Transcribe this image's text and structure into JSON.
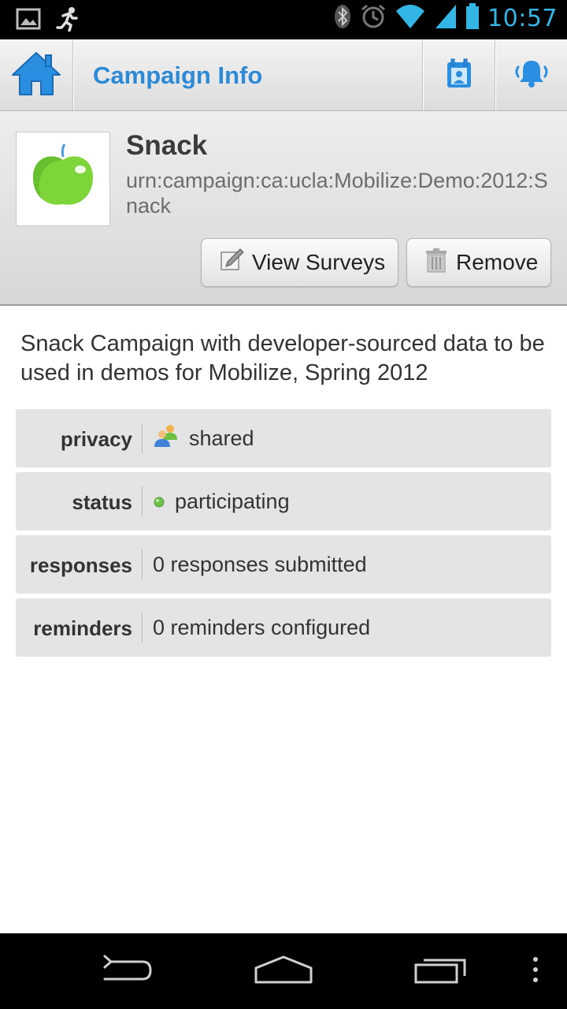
{
  "status_bar": {
    "time": "10:57",
    "icons": [
      "picture-icon",
      "running-icon",
      "bluetooth-icon",
      "alarm-icon",
      "wifi-icon",
      "signal-icon",
      "battery-icon"
    ]
  },
  "action_bar": {
    "title": "Campaign Info",
    "icons": [
      "home-icon",
      "calendar-contact-icon",
      "bell-icon"
    ]
  },
  "campaign": {
    "name": "Snack",
    "urn": "urn:campaign:ca:ucla:Mobilize:Demo:2012:Snack",
    "description": "Snack Campaign with developer-sourced data to be used in demos for Mobilize, Spring 2012",
    "view_surveys_label": "View Surveys",
    "remove_label": "Remove"
  },
  "info": {
    "privacy": {
      "label": "privacy",
      "value": "shared"
    },
    "status": {
      "label": "status",
      "value": "participating"
    },
    "responses": {
      "label": "responses",
      "value": "0 responses submitted"
    },
    "reminders": {
      "label": "reminders",
      "value": "0 reminders configured"
    }
  },
  "colors": {
    "accent": "#33b5e5",
    "title_blue": "#2d8ad7",
    "status_green": "#6cc04a"
  }
}
